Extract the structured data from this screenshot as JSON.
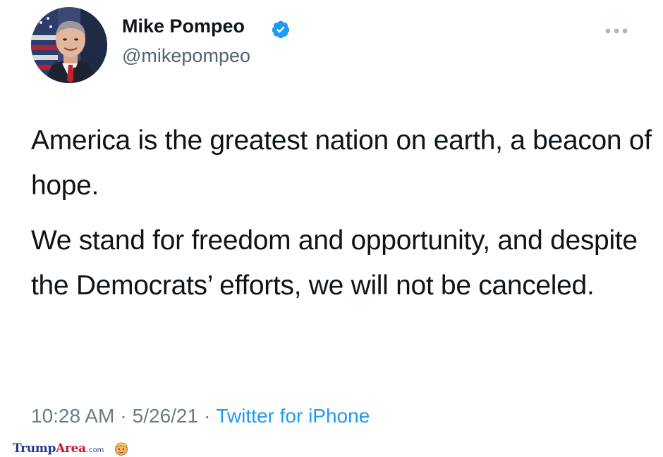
{
  "tweet": {
    "display_name": "Mike Pompeo",
    "verified_icon": "verified-badge-icon",
    "handle": "@mikepompeo",
    "more_icon": "more-options-icon",
    "paragraphs": [
      "America is the greatest nation on earth, a beacon of hope.",
      "We stand for freedom and opportunity, and despite the Democrats’ efforts, we will not be canceled."
    ],
    "time": "10:28 AM",
    "separator": "·",
    "date": "5/26/21",
    "source": "Twitter for iPhone"
  },
  "watermark": {
    "part1": "Trump",
    "part2": "Area",
    "part3": ".com",
    "icon": "trump-face-icon"
  },
  "colors": {
    "text": "#0f1419",
    "secondary": "#536471",
    "link": "#1d9bf0",
    "verified": "#1d9bf0",
    "watermark_blue": "#1f3b8f",
    "watermark_red": "#c8102e"
  }
}
